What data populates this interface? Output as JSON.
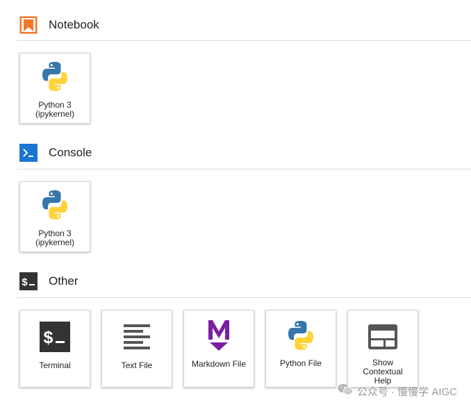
{
  "sections": {
    "notebook": {
      "title": "Notebook",
      "icon": "notebook-bookmark-icon",
      "accent": "#F37726",
      "cards": [
        {
          "label_line1": "Python 3",
          "label_line2": "(ipykernel)",
          "icon": "python-logo-icon"
        }
      ]
    },
    "console": {
      "title": "Console",
      "icon": "console-prompt-icon",
      "accent": "#1976D2",
      "cards": [
        {
          "label_line1": "Python 3",
          "label_line2": "(ipykernel)",
          "icon": "python-logo-icon"
        }
      ]
    },
    "other": {
      "title": "Other",
      "icon": "terminal-icon",
      "accent": "#333333",
      "cards": [
        {
          "label": "Terminal",
          "icon": "terminal-icon"
        },
        {
          "label": "Text File",
          "icon": "text-lines-icon"
        },
        {
          "label": "Markdown File",
          "icon": "markdown-m-icon"
        },
        {
          "label": "Python File",
          "icon": "python-logo-icon"
        },
        {
          "label_line1": "Show",
          "label_line2": "Contextual",
          "label_line3": "Help",
          "icon": "contextual-help-icon"
        }
      ]
    }
  },
  "colors": {
    "python_blue": "#3776AB",
    "python_yellow": "#FFD43B",
    "markdown_purple": "#7B1FA2"
  },
  "watermark": {
    "text": "公众号 · 慢慢学 AIGC",
    "icon": "wechat-icon"
  }
}
